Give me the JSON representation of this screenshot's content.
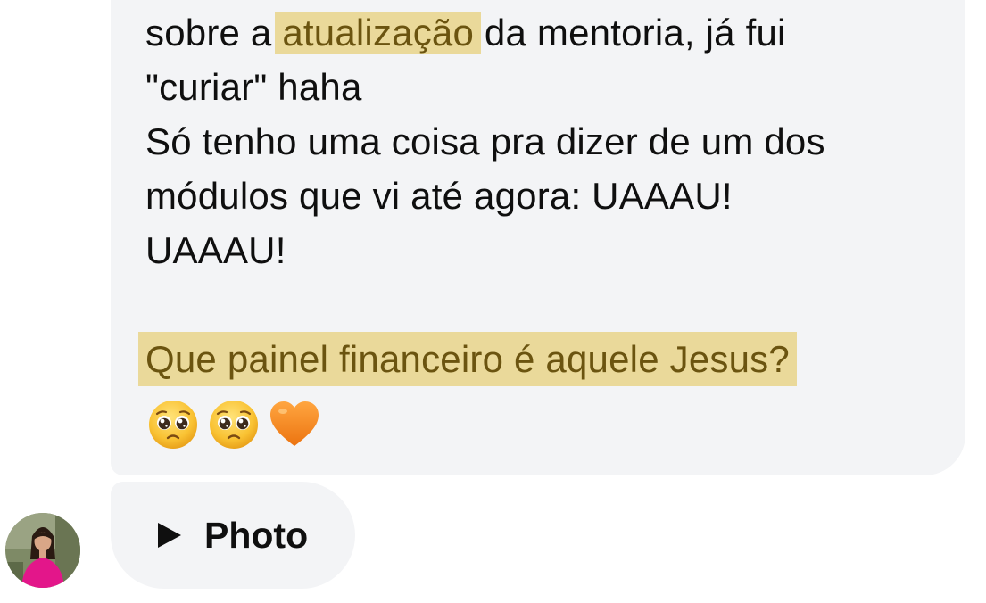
{
  "message": {
    "line1_prefix": "sobre a ",
    "line1_highlight": "atualização",
    "line1_suffix": " da mentoria, já fui",
    "line2": "\"curiar\" haha",
    "line3": "Só tenho uma coisa pra dizer de um dos",
    "line4": "módulos que vi até agora: UAAAU!",
    "line5": "UAAAU!",
    "line6_highlight": "Que painel financeiro é aquele Jesus?",
    "emojis": [
      "pleading-face-emoji",
      "pleading-face-emoji",
      "orange-heart-emoji"
    ]
  },
  "attachment": {
    "label": "Photo",
    "icon": "play-icon"
  },
  "sender": {
    "avatar_icon": "avatar"
  },
  "colors": {
    "bubble": "#f3f4f6",
    "highlight_bg": "#ead99a",
    "highlight_text": "#6b5410",
    "text": "#0f0f0f",
    "heart": "#f0851f"
  }
}
